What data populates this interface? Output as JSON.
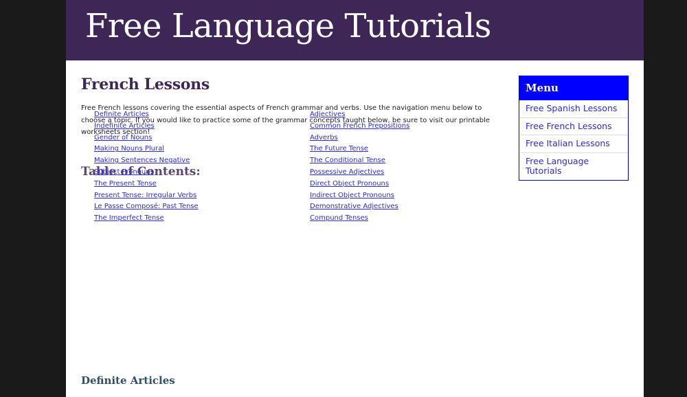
{
  "site": {
    "title": "Free Language Tutorials"
  },
  "main": {
    "title": "French Lessons",
    "intro": "Free French lessons covering the essential aspects of French grammar and verbs. Use the navigation menu below to choose a topic. If you would like to practice some of the grammar concepts taught below, be sure to visit our printable worksheets section!",
    "toc_heading": "Table of Contents:",
    "toc_col1": [
      "Definite Articles",
      "Indefinite Articles",
      "Gender of Nouns",
      "Making Nouns Plural",
      "Making Sentences Negative",
      "Subject Pronouns",
      "The Present Tense",
      "Present Tense: Irregular Verbs",
      "Le Passe Composé: Past Tense",
      "The Imperfect Tense"
    ],
    "toc_col2": [
      "Adjectives",
      "Common French Prepositions",
      "Adverbs",
      "The Future Tense",
      "The Conditional Tense",
      "Possessive Adjectives",
      "Direct Object Pronouns",
      "Indirect Object Pronouns",
      "Demonstrative Adjectives",
      "Compund Tenses"
    ],
    "section_heading": "Definite Articles"
  },
  "menu": {
    "title": "Menu",
    "items": [
      "Free Spanish Lessons",
      "Free French Lessons",
      "Free Italian Lessons",
      "Free Language Tutorials"
    ]
  },
  "colors": {
    "banner": "#3e2757",
    "menu_header": "#0000ff",
    "link": "#2a2ae8",
    "outer_background": "#1a1a1a"
  }
}
